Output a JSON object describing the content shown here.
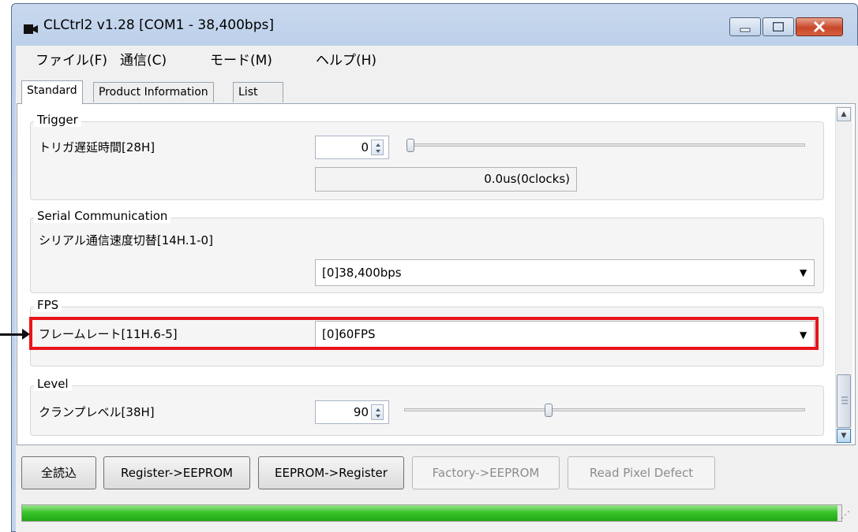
{
  "window": {
    "title": "CLCtrl2 v1.28  [COM1 - 38,400bps]"
  },
  "menu": [
    "ファイル(F)",
    "通信(C)",
    "モード(M)",
    "ヘルプ(H)"
  ],
  "tabs": [
    "Standard",
    "Product Information",
    "List"
  ],
  "groups": {
    "trigger": {
      "title": "Trigger",
      "label": "トリガ遅延時間[28H]",
      "value": "0",
      "readout": "0.0us(0clocks)",
      "slider_fraction": 0.0
    },
    "serial": {
      "title": "Serial Communication",
      "label": "シリアル通信速度切替[14H.1-0]",
      "selected": "[0]38,400bps"
    },
    "fps": {
      "title": "FPS",
      "label": "フレームレート[11H.6-5]",
      "selected": "[0]60FPS"
    },
    "level": {
      "title": "Level",
      "label": "クランプレベル[38H]",
      "value": "90",
      "slider_fraction": 0.35
    }
  },
  "buttons": {
    "read_all": "全読込",
    "reg_to_eeprom": "Register->EEPROM",
    "eeprom_to_reg": "EEPROM->Register",
    "factory_to_eeprom": "Factory->EEPROM",
    "read_pixel_defect": "Read Pixel Defect"
  },
  "progress": {
    "fraction": 0.995
  },
  "colors": {
    "highlight": "#e8141a",
    "progress": "#2fbf22"
  },
  "icons": [
    "app-icon",
    "minimize-icon",
    "maximize-icon",
    "close-icon",
    "spin-up-icon",
    "spin-down-icon",
    "dropdown-arrow-icon",
    "scroll-up-icon",
    "scroll-down-icon",
    "resize-grip-icon"
  ]
}
